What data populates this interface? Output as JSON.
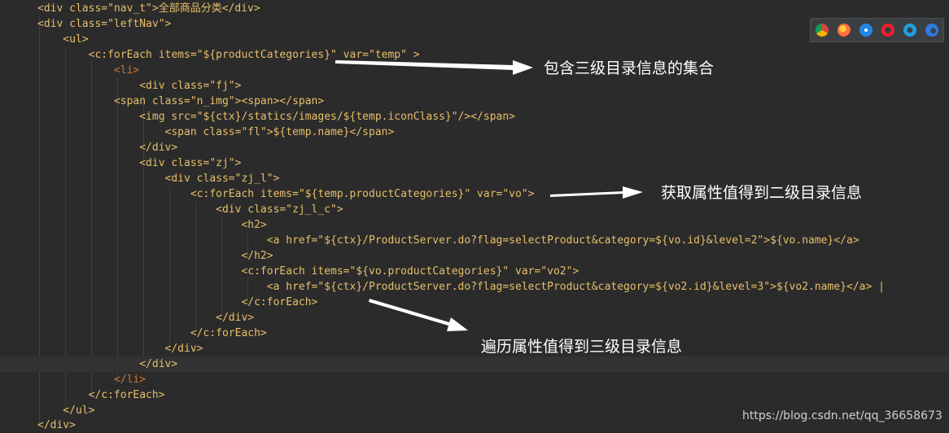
{
  "code_lines": [
    "<div class=\"nav_t\">全部商品分类</div>",
    "<div class=\"leftNav\">",
    "    <ul>",
    "        <c:forEach items=\"${productCategories}\" var=\"temp\" >",
    "            <li>",
    "                <div class=\"fj\">",
    "            <span class=\"n_img\"><span></span>",
    "                <img src=\"${ctx}/statics/images/${temp.iconClass}\"/></span>",
    "                    <span class=\"fl\">${temp.name}</span>",
    "                </div>",
    "                <div class=\"zj\">",
    "                    <div class=\"zj_l\">",
    "                        <c:forEach items=\"${temp.productCategories}\" var=\"vo\">",
    "                            <div class=\"zj_l_c\">",
    "                                <h2>",
    "                                    <a href=\"${ctx}/ProductServer.do?flag=selectProduct&category=${vo.id}&level=2\">${vo.name}</a>",
    "                                </h2>",
    "                                <c:forEach items=\"${vo.productCategories}\" var=\"vo2\">",
    "                                    <a href=\"${ctx}/ProductServer.do?flag=selectProduct&category=${vo2.id}&level=3\">${vo2.name}</a> |",
    "                                </c:forEach>",
    "                            </div>",
    "                        </c:forEach>",
    "                    </div>",
    "                </div>",
    "            </li>",
    "        </c:forEach>",
    "    </ul>",
    "</div>"
  ],
  "annotations": {
    "level3_collection": "包含三级目录信息的集合",
    "get_level2": "获取属性值得到二级目录信息",
    "iterate_level3": "遍历属性值得到三级目录信息"
  },
  "browser_icons": [
    "chrome-icon",
    "firefox-icon",
    "safari-icon",
    "opera-icon",
    "ie-icon",
    "edge-icon"
  ],
  "watermark": "https://blog.csdn.net/qq_36658673",
  "colors": {
    "background": "#2b2b2b",
    "tag": "#e8bf6a",
    "string": "#a5c25c",
    "text": "#a9b7c6",
    "annotation": "#ffffff"
  }
}
